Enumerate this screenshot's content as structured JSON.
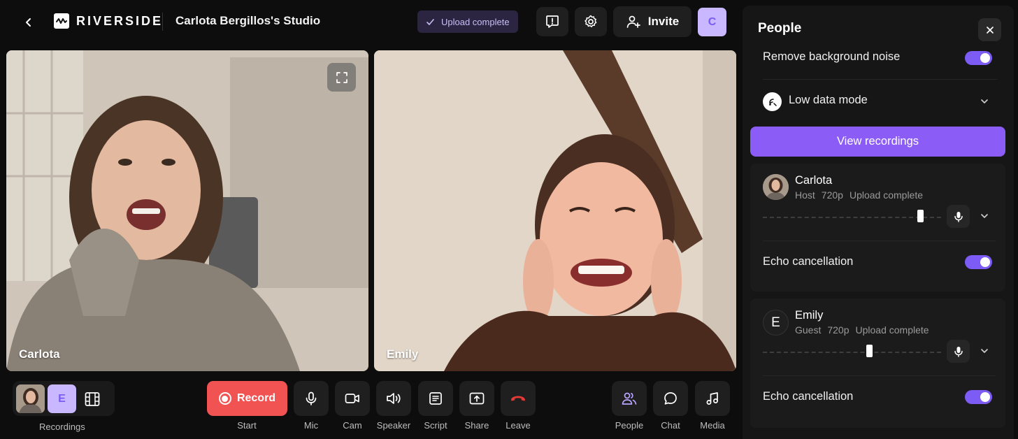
{
  "header": {
    "logo": "RIVERSIDE",
    "studio_title": "Carlota Bergillos's Studio",
    "upload_status": "Upload complete",
    "invite_label": "Invite",
    "user_initial": "C"
  },
  "tiles": [
    {
      "name": "Carlota"
    },
    {
      "name": "Emily"
    }
  ],
  "bottom": {
    "recordings_label": "Recordings",
    "guest_initial": "E",
    "record_label": "Record",
    "controls": [
      {
        "label": "Start",
        "icon": "record-icon"
      },
      {
        "label": "Mic",
        "icon": "microphone-icon"
      },
      {
        "label": "Cam",
        "icon": "camera-icon"
      },
      {
        "label": "Speaker",
        "icon": "speaker-icon"
      },
      {
        "label": "Script",
        "icon": "script-icon"
      },
      {
        "label": "Share",
        "icon": "share-screen-icon"
      },
      {
        "label": "Leave",
        "icon": "hang-up-icon"
      },
      {
        "label": "People",
        "icon": "people-icon"
      },
      {
        "label": "Chat",
        "icon": "chat-icon"
      },
      {
        "label": "Media",
        "icon": "music-note-icon"
      }
    ]
  },
  "panel": {
    "title": "People",
    "noise_label": "Remove background noise",
    "low_data_label": "Low data mode",
    "view_recordings": "View recordings",
    "participants": [
      {
        "name": "Carlota",
        "role": "Host",
        "quality": "720p",
        "status": "Upload complete",
        "echo_label": "Echo cancellation",
        "volume": 0.9
      },
      {
        "name": "Emily",
        "initial": "E",
        "role": "Guest",
        "quality": "720p",
        "status": "Upload complete",
        "echo_label": "Echo cancellation",
        "volume": 0.6
      }
    ]
  },
  "colors": {
    "accent": "#8b5cf6",
    "record": "#f15252",
    "leave": "#e53935"
  }
}
